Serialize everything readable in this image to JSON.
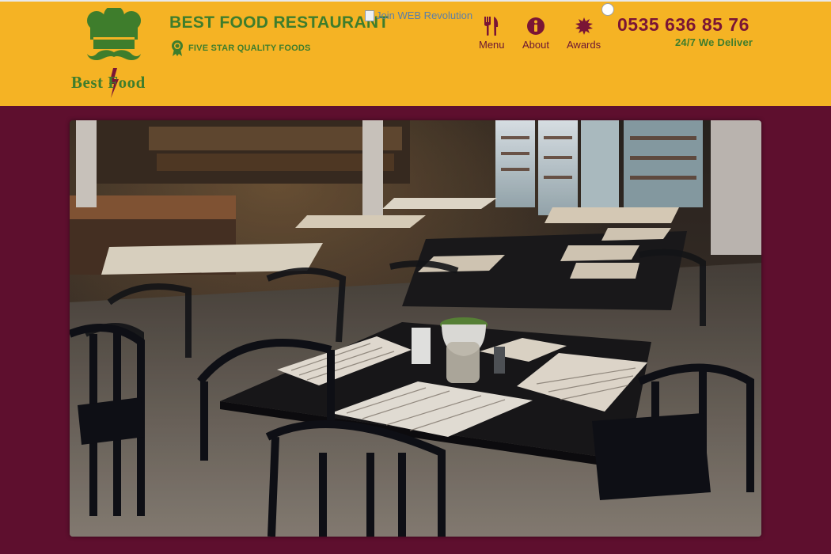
{
  "header": {
    "background": "#f5b324",
    "logo": {
      "text": "Best Food",
      "icon": "chef-hat-mustache-logo"
    },
    "title": "BEST FOOD RESTAURANT",
    "tagline": "FIVE STAR QUALITY FOODS",
    "tagline_icon": "award-ribbon-icon",
    "broken_image_alt": "Join WEB Revolution",
    "nav": [
      {
        "label": "Menu",
        "icon": "fork-knife-icon"
      },
      {
        "label": "About",
        "icon": "info-icon"
      },
      {
        "label": "Awards",
        "icon": "starburst-icon"
      }
    ],
    "phone": "0535 636 85 76",
    "delivery": "24/7 We Deliver"
  },
  "colors": {
    "brand_green": "#3e7d2c",
    "accent_maroon": "#7a1535",
    "page_background": "#5e0f2e"
  },
  "hero": {
    "description_icon": "restaurant-interior-photo"
  }
}
